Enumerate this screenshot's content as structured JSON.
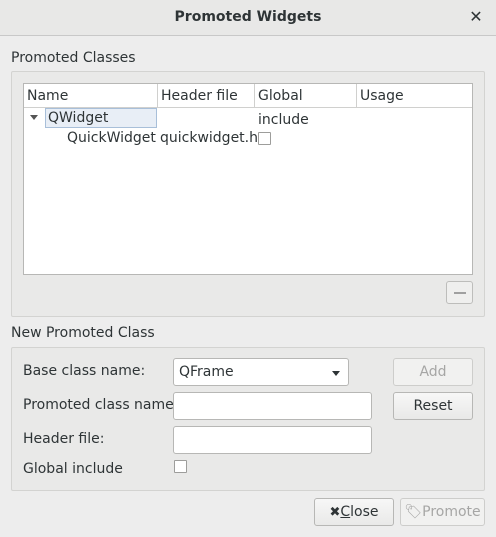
{
  "window": {
    "title": "Promoted Widgets"
  },
  "promoted_classes": {
    "label": "Promoted Classes",
    "columns": [
      "Name",
      "Header file",
      "Global include",
      "Usage"
    ],
    "rows": [
      {
        "name": "QWidget",
        "level": 0,
        "expanded": true
      },
      {
        "name": "QuickWidget",
        "header_file": "quickwidget.h",
        "global_include": false,
        "usage": "",
        "level": 1
      }
    ]
  },
  "new_promoted_class": {
    "label": "New Promoted Class",
    "base_class_label": "Base class name:",
    "base_class_value": "QFrame",
    "promoted_class_label": "Promoted class name:",
    "promoted_class_value": "",
    "header_file_label": "Header file:",
    "header_file_value": "",
    "global_include_label": "Global include",
    "global_include_checked": false,
    "add_label": "Add",
    "reset_label": "Reset"
  },
  "footer": {
    "close_label_prefix": "",
    "close_label_mnemonic": "C",
    "close_label_rest": "lose",
    "promote_label": "Promote"
  },
  "icons": {
    "close_window": "close-icon",
    "remove": "minus-icon",
    "close_button": "x-icon",
    "promote": "promote-tag-icon"
  }
}
